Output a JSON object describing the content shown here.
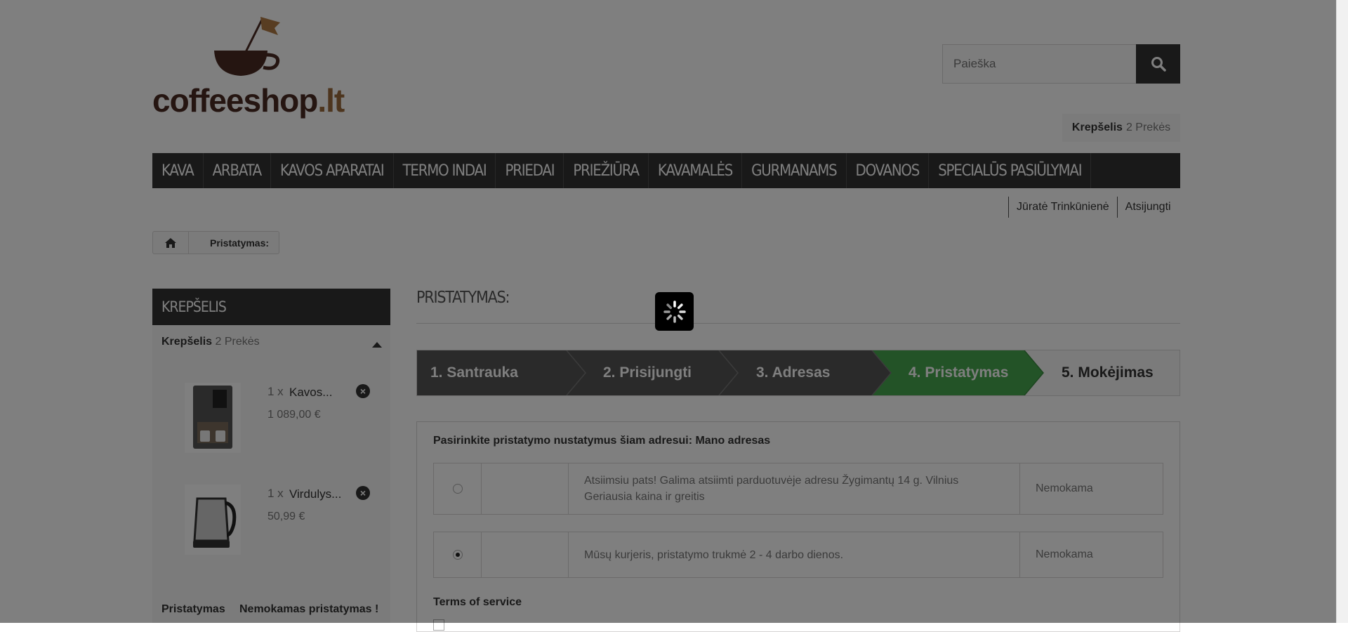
{
  "header": {
    "logo_text_main": "coffeeshop",
    "logo_text_tld": ".lt",
    "search_placeholder": "Paieška",
    "cart_label": "Krepšelis",
    "cart_count": "2 Prekės"
  },
  "menu": [
    "KAVA",
    "ARBATA",
    "KAVOS APARATAI",
    "TERMO INDAI",
    "PRIEDAI",
    "PRIEŽIŪRA",
    "KAVAMALĖS",
    "GURMANAMS",
    "DOVANOS",
    "SPECIALŪS PASIŪLYMAI"
  ],
  "user": {
    "name": "Jūratė Trinkūnienė",
    "logout": "Atsijungti"
  },
  "breadcrumb": {
    "current": "Pristatymas:"
  },
  "sidebar": {
    "title": "KREPŠELIS",
    "cart_label": "Krepšelis",
    "cart_count": "2 Prekės",
    "products": [
      {
        "qty": "1 x",
        "name": "Kavos...",
        "price": "1 089,00 €"
      },
      {
        "qty": "1 x",
        "name": "Virdulys...",
        "price": "50,99 €"
      }
    ],
    "shipping_label": "Pristatymas",
    "shipping_value": "Nemokamas pristatymas !"
  },
  "main": {
    "heading": "PRISTATYMAS:",
    "steps": [
      "1. Santrauka",
      "2. Prisijungti",
      "3. Adresas",
      "4. Pristatymas",
      "5. Mokėjimas"
    ],
    "panel_title": "Pasirinkite pristatymo nustatymus šiam adresui: Mano adresas",
    "carriers": [
      {
        "line1": "Atsiimsiu pats! Galima atsiimti parduotuvėje adresu Žygimantų 14 g. Vilnius",
        "line2": "Geriausia kaina ir greitis",
        "price": "Nemokama",
        "selected": false
      },
      {
        "line1": "Mūsų kurjeris, pristatymo trukmė 2 - 4 darbo dienos.",
        "line2": "",
        "price": "Nemokama",
        "selected": true
      }
    ],
    "tos_title": "Terms of service"
  },
  "colors": {
    "dark": "#333333",
    "step_active": "#46a74e",
    "overlay": "rgba(0,0,0,0.5)"
  }
}
